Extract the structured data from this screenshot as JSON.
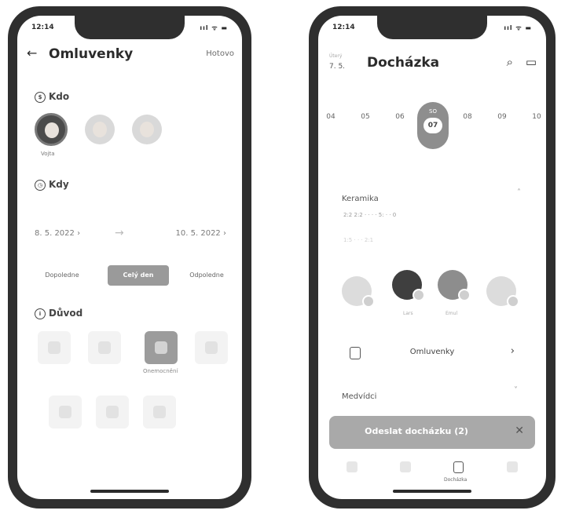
{
  "left": {
    "status_time": "12:14",
    "status_icons": "ııl ᯤ ▬",
    "back_glyph": "←",
    "title": "Omluvenky",
    "done": "Hotovo",
    "who": {
      "icon": "$",
      "label": "Kdo"
    },
    "people": [
      {
        "name": "Vojta"
      },
      {
        "name": ""
      },
      {
        "name": ""
      }
    ],
    "when": {
      "icon": "◷",
      "label": "Kdy"
    },
    "date_from": "8. 5. 2022",
    "date_to": "10. 5. 2022",
    "date_from_chev": "›",
    "date_to_chev": "›",
    "date_sep": "→",
    "segments": [
      "Dopoledne",
      "Celý den",
      "Odpoledne"
    ],
    "reason": {
      "icon": "i",
      "label": "Důvod"
    },
    "reason_selected_label": "Onemocnění"
  },
  "right": {
    "status_time": "12:14",
    "status_icons": "ııl ᯤ ▬",
    "header_weekday": "Úterý",
    "header_date": "7. 5.",
    "title": "Docházka",
    "search_glyph": "⌕",
    "calendar_glyph": "▭",
    "days": [
      "04",
      "05",
      "06",
      "07",
      "08",
      "09",
      "10"
    ],
    "selected_day_weekday": "SO",
    "selected_day_index": 3,
    "group1": {
      "name": "Keramika",
      "chevron": "˄",
      "times": "2:2 2:2 · · · · 5: · · 0",
      "subtimes": "1:5 · · · 2:1"
    },
    "kids": [
      {
        "name": ""
      },
      {
        "name": "Lars"
      },
      {
        "name": "Emul"
      },
      {
        "name": ""
      }
    ],
    "omluvenky_label": "Omluvenky",
    "omluvenky_arrow": "›",
    "group2": {
      "name": "Medvídci",
      "chevron": "˅"
    },
    "send_label": "Odeslat docházku (2)",
    "close_glyph": "✕",
    "tab_selected_label": "Docházka"
  }
}
